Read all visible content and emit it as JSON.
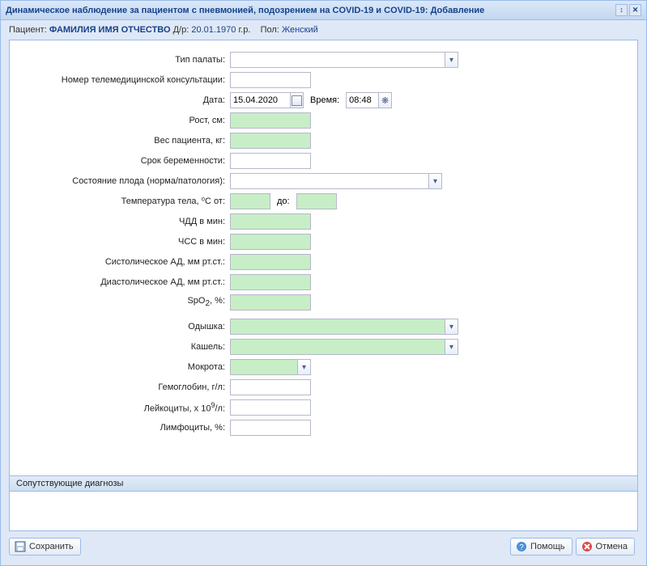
{
  "window": {
    "title": "Динамическое наблюдение за пациентом с пневмонией, подозрением на COVID-19 и COVID-19: Добавление"
  },
  "patient": {
    "label_patient": "Пациент:",
    "name": "ФАМИЛИЯ ИМЯ ОТЧЕСТВО",
    "label_dob": "Д/р:",
    "dob": "20.01.1970",
    "dob_suffix": "г.р.",
    "label_sex": "Пол:",
    "sex": "Женский"
  },
  "form": {
    "ward_type": {
      "label": "Тип палаты:",
      "value": ""
    },
    "telemed": {
      "label": "Номер телемедицинской консультации:",
      "value": ""
    },
    "date": {
      "label": "Дата:",
      "value": "15.04.2020"
    },
    "time": {
      "label": "Время:",
      "value": "08:48"
    },
    "height": {
      "label": "Рост, см:",
      "value": ""
    },
    "weight": {
      "label": "Вес пациента, кг:",
      "value": ""
    },
    "gestation": {
      "label": "Срок беременности:",
      "value": ""
    },
    "fetus_state": {
      "label": "Состояние плода (норма/патология):",
      "value": ""
    },
    "temp": {
      "label": "Температура тела, ⁰С от:",
      "to_label": "до:",
      "from": "",
      "to": ""
    },
    "rr": {
      "label": "ЧДД в мин:",
      "value": ""
    },
    "hr": {
      "label": "ЧСС в мин:",
      "value": ""
    },
    "sbp": {
      "label": "Систолическое АД, мм рт.ст.:",
      "value": ""
    },
    "dbp": {
      "label": "Диастолическое АД, мм рт.ст.:",
      "value": ""
    },
    "spo2": {
      "label_pre": "SpO",
      "label_sub": "2",
      "label_post": ", %:",
      "value": ""
    },
    "dyspnea": {
      "label": "Одышка:",
      "value": ""
    },
    "cough": {
      "label": "Кашель:",
      "value": ""
    },
    "sputum": {
      "label": "Мокрота:",
      "value": ""
    },
    "hb": {
      "label": "Гемоглобин, г/л:",
      "value": ""
    },
    "wbc": {
      "label_pre": "Лейкоциты, х 10",
      "label_sup": "9",
      "label_post": "/л:",
      "value": ""
    },
    "lymph": {
      "label": "Лимфоциты, %:",
      "value": ""
    }
  },
  "panels": {
    "diag": "Сопутствующие диагнозы"
  },
  "buttons": {
    "save": "Сохранить",
    "help": "Помощь",
    "cancel": "Отмена"
  }
}
